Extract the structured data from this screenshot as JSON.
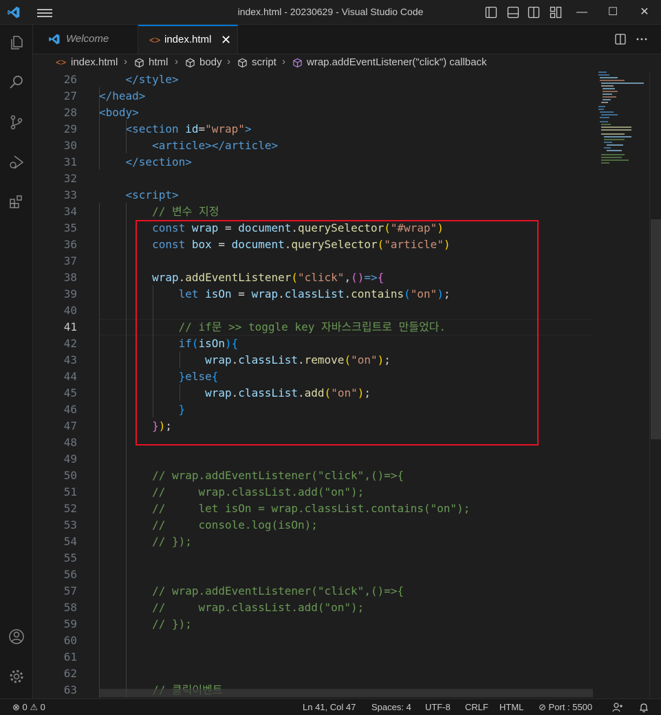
{
  "window": {
    "title": "index.html - 20230629 - Visual Studio Code",
    "minimize": "—",
    "maximize": "☐",
    "close": "✕"
  },
  "tabs": [
    {
      "label": "Welcome",
      "active": false
    },
    {
      "label": "index.html",
      "active": true,
      "close": "✕"
    }
  ],
  "breadcrumb": [
    "index.html",
    "html",
    "body",
    "script",
    "wrap.addEventListener(\"click\") callback"
  ],
  "editor": {
    "active_line": 41,
    "lines": [
      {
        "n": "26",
        "tokens": [
          [
            "tag",
            "    </style>"
          ]
        ]
      },
      {
        "n": "27",
        "tokens": [
          [
            "tag",
            "</head>"
          ]
        ]
      },
      {
        "n": "28",
        "tokens": [
          [
            "tag",
            "<body>"
          ]
        ]
      },
      {
        "n": "29",
        "tokens": [
          [
            "tag",
            "    <section "
          ],
          [
            "attr",
            "id"
          ],
          [
            "op",
            "="
          ],
          [
            "str",
            "\"wrap\""
          ],
          [
            "tag",
            ">"
          ]
        ]
      },
      {
        "n": "30",
        "tokens": [
          [
            "tag",
            "        <article></article>"
          ]
        ]
      },
      {
        "n": "31",
        "tokens": [
          [
            "tag",
            "    </section>"
          ]
        ]
      },
      {
        "n": "32",
        "tokens": []
      },
      {
        "n": "33",
        "tokens": [
          [
            "tag",
            "    <script>"
          ]
        ]
      },
      {
        "n": "34",
        "tokens": [
          [
            "cm",
            "        // 변수 지정"
          ]
        ]
      },
      {
        "n": "35",
        "tokens": [
          [
            "kw",
            "        const "
          ],
          [
            "var",
            "wrap"
          ],
          [
            "op",
            " = "
          ],
          [
            "var",
            "document"
          ],
          [
            "op",
            "."
          ],
          [
            "fn",
            "querySelector"
          ],
          [
            "br1",
            "("
          ],
          [
            "str",
            "\"#wrap\""
          ],
          [
            "br1",
            ")"
          ]
        ]
      },
      {
        "n": "36",
        "tokens": [
          [
            "kw",
            "        const "
          ],
          [
            "var",
            "box"
          ],
          [
            "op",
            " = "
          ],
          [
            "var",
            "document"
          ],
          [
            "op",
            "."
          ],
          [
            "fn",
            "querySelector"
          ],
          [
            "br1",
            "("
          ],
          [
            "str",
            "\"article\""
          ],
          [
            "br1",
            ")"
          ]
        ]
      },
      {
        "n": "37",
        "tokens": []
      },
      {
        "n": "38",
        "tokens": [
          [
            "var",
            "        wrap"
          ],
          [
            "op",
            "."
          ],
          [
            "fn",
            "addEventListener"
          ],
          [
            "br1",
            "("
          ],
          [
            "str",
            "\"click\""
          ],
          [
            "op",
            ","
          ],
          [
            "br2",
            "()"
          ],
          [
            "kw",
            "=>"
          ],
          [
            "br2",
            "{"
          ]
        ]
      },
      {
        "n": "39",
        "tokens": [
          [
            "kw",
            "            let "
          ],
          [
            "var",
            "isOn"
          ],
          [
            "op",
            " = "
          ],
          [
            "var",
            "wrap"
          ],
          [
            "op",
            "."
          ],
          [
            "var",
            "classList"
          ],
          [
            "op",
            "."
          ],
          [
            "fn",
            "contains"
          ],
          [
            "br3",
            "("
          ],
          [
            "str",
            "\"on\""
          ],
          [
            "br3",
            ")"
          ],
          [
            "op",
            ";"
          ]
        ]
      },
      {
        "n": "40",
        "tokens": []
      },
      {
        "n": "41",
        "tokens": [
          [
            "cm",
            "            // if문 >> toggle key 자바스크립트로 만들었다."
          ]
        ]
      },
      {
        "n": "42",
        "tokens": [
          [
            "kw",
            "            if"
          ],
          [
            "br3",
            "("
          ],
          [
            "var",
            "isOn"
          ],
          [
            "br3",
            ")"
          ],
          [
            "br3",
            "{"
          ]
        ]
      },
      {
        "n": "43",
        "tokens": [
          [
            "var",
            "                wrap"
          ],
          [
            "op",
            "."
          ],
          [
            "var",
            "classList"
          ],
          [
            "op",
            "."
          ],
          [
            "fn",
            "remove"
          ],
          [
            "br1",
            "("
          ],
          [
            "str",
            "\"on\""
          ],
          [
            "br1",
            ")"
          ],
          [
            "op",
            ";"
          ]
        ]
      },
      {
        "n": "44",
        "tokens": [
          [
            "br3",
            "            }"
          ],
          [
            "kw",
            "else"
          ],
          [
            "br3",
            "{"
          ]
        ]
      },
      {
        "n": "45",
        "tokens": [
          [
            "var",
            "                wrap"
          ],
          [
            "op",
            "."
          ],
          [
            "var",
            "classList"
          ],
          [
            "op",
            "."
          ],
          [
            "fn",
            "add"
          ],
          [
            "br1",
            "("
          ],
          [
            "str",
            "\"on\""
          ],
          [
            "br1",
            ")"
          ],
          [
            "op",
            ";"
          ]
        ]
      },
      {
        "n": "46",
        "tokens": [
          [
            "br3",
            "            }"
          ]
        ]
      },
      {
        "n": "47",
        "tokens": [
          [
            "br2",
            "        }"
          ],
          [
            "br1",
            ")"
          ],
          [
            "op",
            ";"
          ]
        ]
      },
      {
        "n": "48",
        "tokens": []
      },
      {
        "n": "49",
        "tokens": []
      },
      {
        "n": "50",
        "tokens": [
          [
            "cm",
            "        // wrap.addEventListener(\"click\",()=>{"
          ]
        ]
      },
      {
        "n": "51",
        "tokens": [
          [
            "cm",
            "        //     wrap.classList.add(\"on\");"
          ]
        ]
      },
      {
        "n": "52",
        "tokens": [
          [
            "cm",
            "        //     let isOn = wrap.classList.contains(\"on\");"
          ]
        ]
      },
      {
        "n": "53",
        "tokens": [
          [
            "cm",
            "        //     console.log(isOn);"
          ]
        ]
      },
      {
        "n": "54",
        "tokens": [
          [
            "cm",
            "        // });"
          ]
        ]
      },
      {
        "n": "55",
        "tokens": []
      },
      {
        "n": "56",
        "tokens": []
      },
      {
        "n": "57",
        "tokens": [
          [
            "cm",
            "        // wrap.addEventListener(\"click\",()=>{"
          ]
        ]
      },
      {
        "n": "58",
        "tokens": [
          [
            "cm",
            "        //     wrap.classList.add(\"on\");"
          ]
        ]
      },
      {
        "n": "59",
        "tokens": [
          [
            "cm",
            "        // });"
          ]
        ]
      },
      {
        "n": "60",
        "tokens": []
      },
      {
        "n": "61",
        "tokens": []
      },
      {
        "n": "62",
        "tokens": []
      },
      {
        "n": "63",
        "tokens": [
          [
            "cm",
            "        // 클릭이벤트"
          ]
        ]
      }
    ]
  },
  "statusbar": {
    "errors": "0",
    "warnings": "0",
    "position": "Ln 41, Col 47",
    "spaces": "Spaces: 4",
    "encoding": "UTF-8",
    "eol": "CRLF",
    "language": "HTML",
    "port": "Port : 5500"
  },
  "colors": {
    "accent": "#0078d4",
    "highlight_box": "#e81123"
  },
  "icons": [
    "vscode-logo-icon",
    "menu-icon",
    "explorer-icon",
    "search-icon",
    "source-control-icon",
    "run-debug-icon",
    "extensions-icon",
    "accounts-icon",
    "manage-gear-icon",
    "split-editor-icon",
    "more-actions-icon"
  ]
}
